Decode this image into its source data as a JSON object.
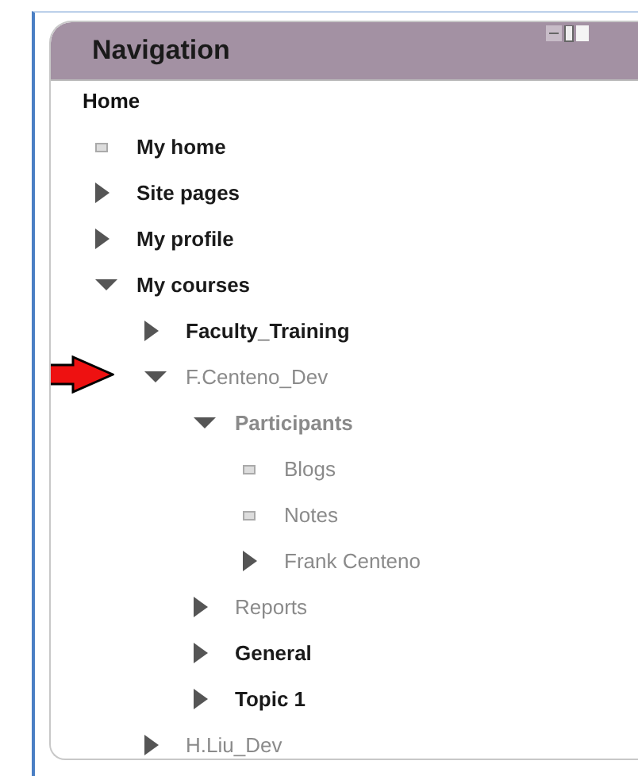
{
  "block": {
    "title": "Navigation"
  },
  "home": {
    "label": "Home"
  },
  "items": [
    {
      "label": "My home",
      "kind": "leaf",
      "dimmed": false,
      "bold": true,
      "pointed": false
    },
    {
      "label": "Site pages",
      "kind": "branch",
      "expanded": false,
      "dimmed": false,
      "bold": true,
      "pointed": false
    },
    {
      "label": "My profile",
      "kind": "branch",
      "expanded": false,
      "dimmed": false,
      "bold": true,
      "pointed": false
    },
    {
      "label": "My courses",
      "kind": "branch",
      "expanded": true,
      "dimmed": false,
      "bold": true,
      "pointed": false,
      "children": [
        {
          "label": "Faculty_Training",
          "kind": "branch",
          "expanded": false,
          "dimmed": false,
          "bold": true,
          "pointed": false
        },
        {
          "label": "F.Centeno_Dev",
          "kind": "branch",
          "expanded": true,
          "dimmed": true,
          "bold": false,
          "pointed": true,
          "children": [
            {
              "label": "Participants",
              "kind": "branch",
              "expanded": true,
              "dimmed": true,
              "bold": true,
              "pointed": false,
              "children": [
                {
                  "label": "Blogs",
                  "kind": "leaf",
                  "dimmed": true,
                  "bold": false,
                  "pointed": false
                },
                {
                  "label": "Notes",
                  "kind": "leaf",
                  "dimmed": true,
                  "bold": false,
                  "pointed": false
                },
                {
                  "label": "Frank Centeno",
                  "kind": "branch",
                  "expanded": false,
                  "dimmed": true,
                  "bold": false,
                  "pointed": false
                }
              ]
            },
            {
              "label": "Reports",
              "kind": "branch",
              "expanded": false,
              "dimmed": true,
              "bold": false,
              "pointed": false
            },
            {
              "label": "General",
              "kind": "branch",
              "expanded": false,
              "dimmed": false,
              "bold": true,
              "pointed": false
            },
            {
              "label": "Topic 1",
              "kind": "branch",
              "expanded": false,
              "dimmed": false,
              "bold": true,
              "pointed": false
            }
          ]
        },
        {
          "label": "H.Liu_Dev",
          "kind": "branch",
          "expanded": false,
          "dimmed": true,
          "bold": false,
          "pointed": false
        }
      ]
    }
  ]
}
